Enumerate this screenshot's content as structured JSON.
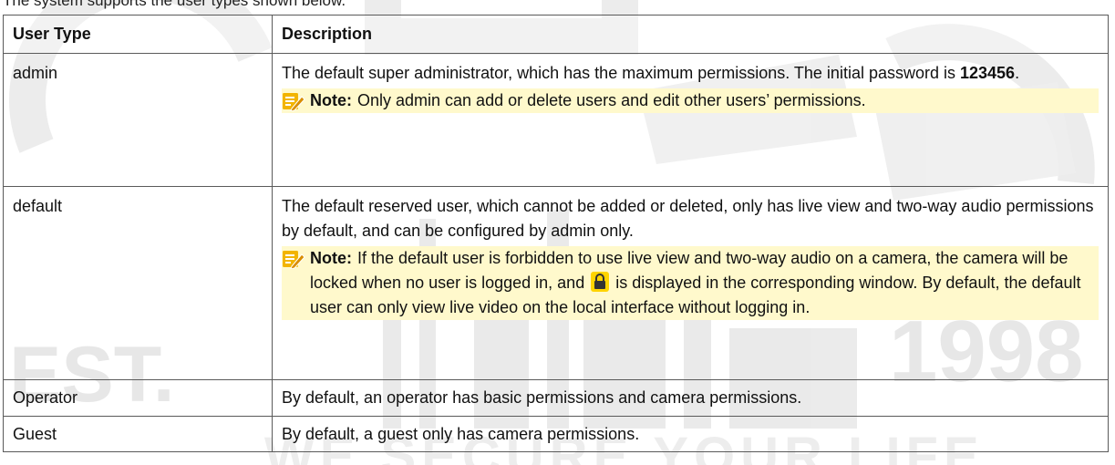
{
  "intro": "The system supports the user types shown below.",
  "table": {
    "headers": [
      "User Type",
      "Description"
    ],
    "rows": {
      "admin": {
        "type": "admin",
        "desc_pre": "The default super administrator, which has the maximum permissions. The initial password is ",
        "desc_bold": "123456",
        "desc_post": ".",
        "note_label": "Note:",
        "note_text": "Only admin can add or delete users and edit other users’ permissions."
      },
      "default": {
        "type": "default",
        "desc": "The default reserved user, which cannot be added or deleted, only has live view and two-way audio permissions by default, and can be configured by admin only.",
        "note_label": "Note:",
        "note_pre": "If the default user is forbidden to use live view and two-way audio on a camera, the camera will be locked when no user is logged in, and ",
        "note_post": " is displayed in the corresponding window. By default, the default user can only view live video on the local interface without logging in."
      },
      "operator": {
        "type": "Operator",
        "desc": "By default, an operator has basic permissions and camera permissions."
      },
      "guest": {
        "type": "Guest",
        "desc": "By default, a guest only has camera permissions."
      }
    }
  },
  "icons": {
    "note": "note-pencil-icon",
    "lock": "lock-icon"
  },
  "colors": {
    "note_highlight": "#fff9cc",
    "note_icon": "#e0a800",
    "lock_bg": "#ffd400",
    "border": "#5a5a5a"
  },
  "watermark": {
    "year": "1998",
    "est": "EST.",
    "slogan": "WE SECURE YOUR LIFE"
  }
}
